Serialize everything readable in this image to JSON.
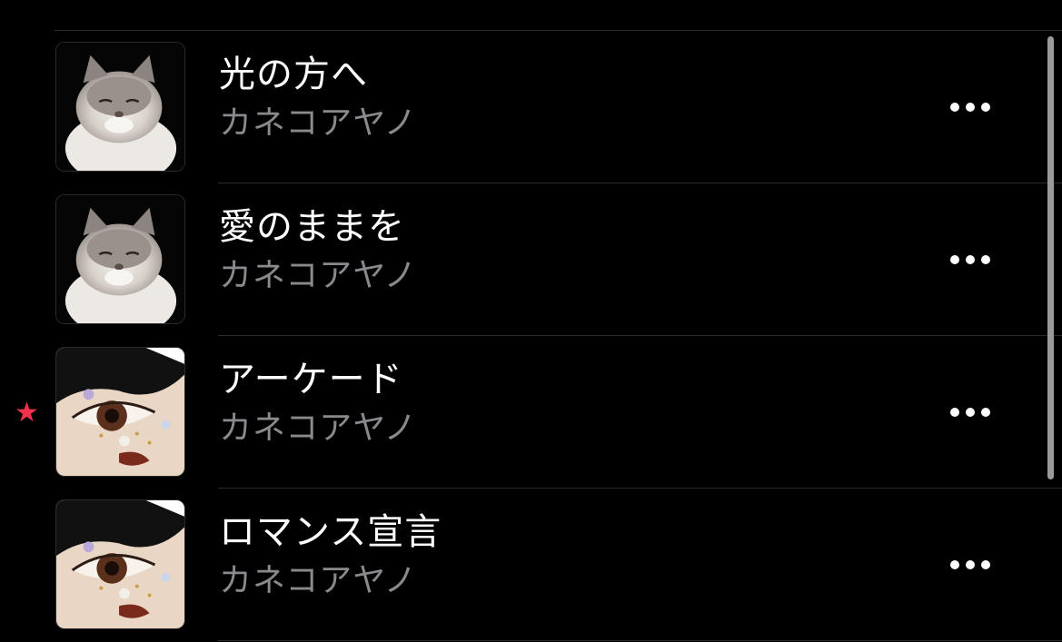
{
  "songs": [
    {
      "title": "光の方へ",
      "artist": "カネコアヤノ",
      "artwork": "cat-artwork",
      "favorite": false,
      "more_icon": "ellipsis-icon"
    },
    {
      "title": "愛のままを",
      "artist": "カネコアヤノ",
      "artwork": "cat-artwork",
      "favorite": false,
      "more_icon": "ellipsis-icon"
    },
    {
      "title": "アーケード",
      "artist": "カネコアヤノ",
      "artwork": "eye-artwork",
      "favorite": true,
      "more_icon": "ellipsis-icon"
    },
    {
      "title": "ロマンス宣言",
      "artist": "カネコアヤノ",
      "artwork": "eye-artwork",
      "favorite": false,
      "more_icon": "ellipsis-icon"
    }
  ],
  "favorite_icon": "star-icon",
  "colors": {
    "background": "#000000",
    "title": "#ffffff",
    "artist": "#8a8a8e",
    "divider": "#2b2b2d",
    "favorite_star": "#f2324b"
  }
}
